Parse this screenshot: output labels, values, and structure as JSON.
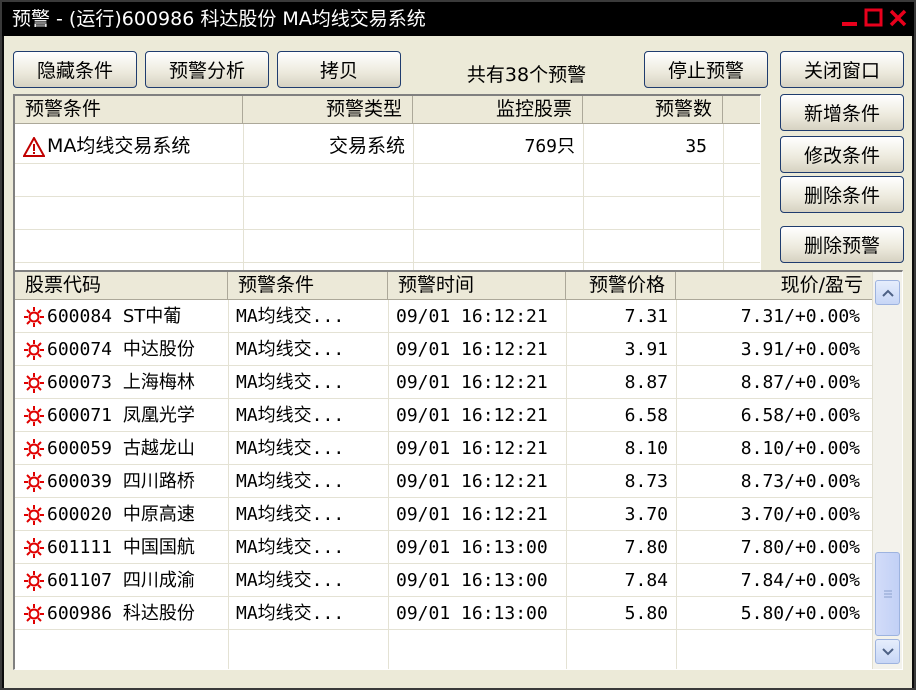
{
  "window": {
    "title": "预警 - (运行)600986 科达股份 MA均线交易系统"
  },
  "toolbar": {
    "hide_conditions": "隐藏条件",
    "alert_analysis": "预警分析",
    "copy": "拷贝",
    "alert_count_text": "共有38个预警",
    "stop_alert": "停止预警",
    "close_window": "关闭窗口"
  },
  "side_buttons": {
    "add_condition": "新增条件",
    "edit_condition": "修改条件",
    "delete_condition": "删除条件",
    "delete_alert": "删除预警"
  },
  "conditions_table": {
    "headers": [
      "预警条件",
      "预警类型",
      "监控股票",
      "预警数"
    ],
    "rows": [
      {
        "icon": "warning-triangle-icon",
        "condition": "MA均线交易系统",
        "type": "交易系统",
        "stocks": "769只",
        "count": "35"
      }
    ]
  },
  "alerts_table": {
    "headers": [
      "股票代码",
      "预警条件",
      "预警时间",
      "预警价格",
      "现价/盈亏"
    ],
    "rows": [
      {
        "icon": "alert-burst-icon",
        "code": "600084",
        "name": "ST中葡",
        "condition": "MA均线交...",
        "time": "09/01 16:12:21",
        "price": "7.31",
        "current": "7.31/+0.00%"
      },
      {
        "icon": "alert-burst-icon",
        "code": "600074",
        "name": "中达股份",
        "condition": "MA均线交...",
        "time": "09/01 16:12:21",
        "price": "3.91",
        "current": "3.91/+0.00%"
      },
      {
        "icon": "alert-burst-icon",
        "code": "600073",
        "name": "上海梅林",
        "condition": "MA均线交...",
        "time": "09/01 16:12:21",
        "price": "8.87",
        "current": "8.87/+0.00%"
      },
      {
        "icon": "alert-burst-icon",
        "code": "600071",
        "name": "凤凰光学",
        "condition": "MA均线交...",
        "time": "09/01 16:12:21",
        "price": "6.58",
        "current": "6.58/+0.00%"
      },
      {
        "icon": "alert-burst-icon",
        "code": "600059",
        "name": "古越龙山",
        "condition": "MA均线交...",
        "time": "09/01 16:12:21",
        "price": "8.10",
        "current": "8.10/+0.00%"
      },
      {
        "icon": "alert-burst-icon",
        "code": "600039",
        "name": "四川路桥",
        "condition": "MA均线交...",
        "time": "09/01 16:12:21",
        "price": "8.73",
        "current": "8.73/+0.00%"
      },
      {
        "icon": "alert-burst-icon",
        "code": "600020",
        "name": "中原高速",
        "condition": "MA均线交...",
        "time": "09/01 16:12:21",
        "price": "3.70",
        "current": "3.70/+0.00%"
      },
      {
        "icon": "alert-burst-icon",
        "code": "601111",
        "name": "中国国航",
        "condition": "MA均线交...",
        "time": "09/01 16:13:00",
        "price": "7.80",
        "current": "7.80/+0.00%"
      },
      {
        "icon": "alert-burst-icon",
        "code": "601107",
        "name": "四川成渝",
        "condition": "MA均线交...",
        "time": "09/01 16:13:00",
        "price": "7.84",
        "current": "7.84/+0.00%"
      },
      {
        "icon": "alert-burst-icon",
        "code": "600986",
        "name": "科达股份",
        "condition": "MA均线交...",
        "time": "09/01 16:13:00",
        "price": "5.80",
        "current": "5.80/+0.00%"
      }
    ]
  },
  "colors": {
    "alert_icon": "#e00000",
    "warning_icon": "#c00000",
    "window_control": "#e8001c"
  }
}
